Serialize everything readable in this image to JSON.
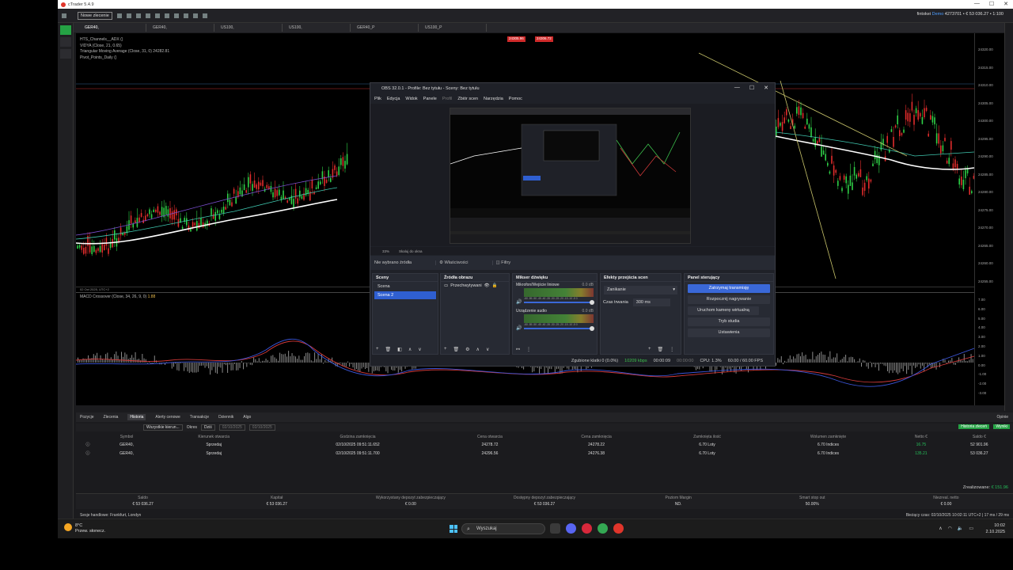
{
  "app": {
    "title": "cTrader 5.4.9",
    "new_order": "Nowe zlecenie",
    "account": "fintokei",
    "account_mode": "Demo",
    "account_info": "4273701 • € 53 036.27 • 1:100",
    "minimize": "—",
    "maximize": "☐",
    "close": "✕"
  },
  "chart_tabs": [
    "GER40,",
    "GER40,",
    "US100,",
    "US100,",
    "GER40_P",
    "US100_P"
  ],
  "chart": {
    "indicators": [
      "HTS_Channels__ADX ()",
      "VIDYA (Close, 21, 0.65)",
      "Triangular Moving Average (Close, 31, 0) 24282.81",
      "Pivot_Points_Daily ()"
    ],
    "price_sell": "24305.96",
    "price_buy": "24306.72",
    "y_ticks": [
      "24320.00",
      "24315.00",
      "24310.00",
      "24305.00",
      "24300.00",
      "24295.00",
      "24290.00",
      "24285.00",
      "24280.00",
      "24275.00",
      "24270.00",
      "24265.00",
      "24260.00",
      "24255.00"
    ],
    "x_label": "02 Oct 2025, UTC+2",
    "macd_label": "MACD Crossover (Close, 34, 26, 9, 0)",
    "macd_value": "1.88",
    "macd_ticks": [
      "7.00",
      "6.00",
      "5.00",
      "4.00",
      "3.00",
      "2.00",
      "1.00",
      "0.00",
      "-1.00",
      "-2.00",
      "-3.00"
    ]
  },
  "bottom_tabs": [
    "Pozycje",
    "Zlecenia",
    "Historia",
    "Alerty cenowe",
    "Transakcje",
    "Dziennik",
    "Algo"
  ],
  "bottom_tab_active": "Historia",
  "open_label": "Opinie",
  "filters": {
    "all": "Wszystkie kierun...",
    "period_label": "Okres",
    "period": "Dziś",
    "date_from": "02/10/2025",
    "date_to": "02/10/2025"
  },
  "history_btn": "Historia zleceń",
  "export_btn": "Wyniki",
  "history": {
    "headers": [
      "Symbol",
      "Kierunek otwarcia",
      "Godzina zamknięcia",
      "Cena otwarcia",
      "Cena zamknięcia",
      "Zamknięta ilość",
      "Wolumen zamknięte",
      "Netto €",
      "Saldo €"
    ],
    "rows": [
      [
        "GER40,",
        "Sprzedaj",
        "02/10/2025 09:51:11.652",
        "24278.72",
        "24278.22",
        "6.70 Loty",
        "6.70 Indices",
        "16.75",
        "52 901.96"
      ],
      [
        "GER40,",
        "Sprzedaj",
        "02/10/2025 09:51:11.700",
        "24296.56",
        "24276.38",
        "6.70 Loty",
        "6.70 Indices",
        "135.21",
        "53 036.27"
      ]
    ]
  },
  "realized": {
    "label": "Zrealizowane:",
    "value": "€ 151.96"
  },
  "summary": [
    {
      "label": "Saldo",
      "value": "€ 53 036.27"
    },
    {
      "label": "Kapitał",
      "value": "€ 53 036.27"
    },
    {
      "label": "Wykorzystany depozyt zabezpieczający",
      "value": "€ 0.00"
    },
    {
      "label": "Dostępny depozyt zabezpieczający",
      "value": "€ 53 036.27"
    },
    {
      "label": "Poziom Margin",
      "value": "ND."
    },
    {
      "label": "Smart stop out",
      "value": "50.00%"
    },
    {
      "label": "Niezreal. netto",
      "value": "€ 0.00"
    }
  ],
  "status": {
    "sessions": "Sesje handlowe: Frankfurt, Londyn",
    "right": "Bieżący czas: 02/10/2025 10:02:11   UTC+2   |   17 ms / 29 ms"
  },
  "obs": {
    "title": "OBS 32.0.1 - Profile: Bez tytułu - Sceny: Bez tytułu",
    "menu": [
      "Plik",
      "Edycja",
      "Widok",
      "Panele",
      "Profil",
      "Zbiór scen",
      "Narzędzia",
      "Pomoc"
    ],
    "zoom": "33%",
    "scale": "Skaluj do okna",
    "no_source": "Nie wybrano źródła",
    "properties": "Właściwości",
    "filters": "Filtry",
    "scenes_title": "Sceny",
    "scenes": [
      "Scena",
      "Scena 2"
    ],
    "sources_title": "Źródła obrazu",
    "sources": [
      "Przechwytywani"
    ],
    "mixer_title": "Mikser dźwięku",
    "mixer": [
      {
        "name": "Mikrofon/Wejście liniowe",
        "db": "0.0 dB"
      },
      {
        "name": "Urządzenie audio",
        "db": "0.0 dB"
      }
    ],
    "meter_scale": "-60 -55 -50 -45 -40 -35 -30 -25 -20 -15 -10 -5 0",
    "transitions_title": "Efekty przejścia scen",
    "transition": "Zanikanie",
    "duration_label": "Czas trwania",
    "duration": "300 ms",
    "controls_title": "Panel sterujący",
    "controls": [
      "Zatrzymaj transmisję",
      "Rozpocznij nagrywanie",
      "Uruchom kamerę wirtualną",
      "Tryb studia",
      "Ustawienia"
    ],
    "status": {
      "dropped": "Zgubione klatki 0 (0.0%)",
      "bitrate": "10209 kbps",
      "live": "00:00:09",
      "rec": "00:00:00",
      "cpu": "CPU: 1.3%",
      "fps": "60.00 / 60.00 FPS"
    }
  },
  "taskbar": {
    "temp": "8°C",
    "weather": "Przew. słonecz.",
    "search": "Wyszukaj",
    "time": "10:02",
    "date": "2.10.2025"
  }
}
